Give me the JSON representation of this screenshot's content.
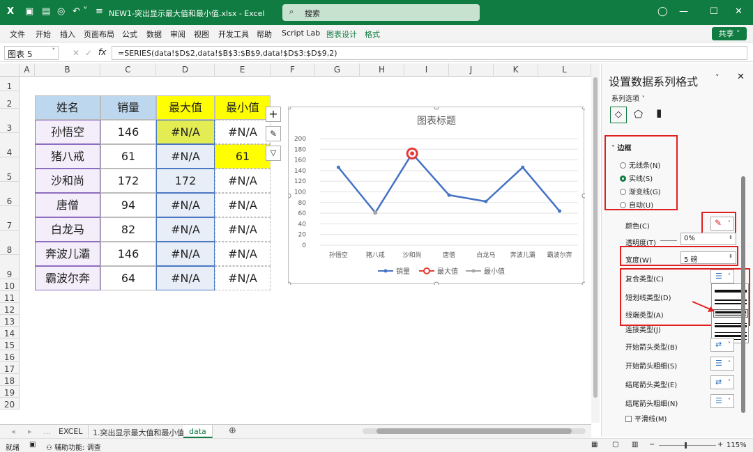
{
  "window": {
    "title": "NEW1-突出显示最大值和最小值.xlsx  -  Excel",
    "search_placeholder": "搜索"
  },
  "menu": [
    "文件",
    "开始",
    "插入",
    "页面布局",
    "公式",
    "数据",
    "审阅",
    "视图",
    "开发工具",
    "帮助",
    "Script Lab",
    "图表设计",
    "格式"
  ],
  "share_label": "共享",
  "formula_bar": {
    "name_box": "图表 5",
    "fx": "fx",
    "formula": "=SERIES(data!$D$2,data!$B$3:$B$9,data!$D$3:$D$9,2)"
  },
  "columns": [
    "A",
    "B",
    "C",
    "D",
    "E",
    "F",
    "G",
    "H",
    "I",
    "J",
    "K",
    "L"
  ],
  "rows": [
    "1",
    "2",
    "3",
    "4",
    "5",
    "6",
    "7",
    "8",
    "9",
    "10",
    "11",
    "12",
    "13",
    "14",
    "15",
    "16",
    "17",
    "18",
    "19",
    "20"
  ],
  "table": {
    "headers": [
      "姓名",
      "销量",
      "最大值",
      "最小值"
    ],
    "rows": [
      [
        "孙悟空",
        "146",
        "#N/A",
        "#N/A"
      ],
      [
        "猪八戒",
        "61",
        "#N/A",
        "61"
      ],
      [
        "沙和尚",
        "172",
        "172",
        "#N/A"
      ],
      [
        "唐僧",
        "94",
        "#N/A",
        "#N/A"
      ],
      [
        "白龙马",
        "82",
        "#N/A",
        "#N/A"
      ],
      [
        "奔波儿灞",
        "146",
        "#N/A",
        "#N/A"
      ],
      [
        "霸波尔奔",
        "64",
        "#N/A",
        "#N/A"
      ]
    ]
  },
  "chart_data": {
    "type": "line",
    "title": "图表标题",
    "categories": [
      "孙悟空",
      "猪八戒",
      "沙和尚",
      "唐僧",
      "白龙马",
      "奔波儿灞",
      "霸波尔奔"
    ],
    "series": [
      {
        "name": "销量",
        "values": [
          146,
          61,
          172,
          94,
          82,
          146,
          64
        ],
        "color": "#4472c4"
      },
      {
        "name": "最大值",
        "values": [
          null,
          null,
          172,
          null,
          null,
          null,
          null
        ],
        "color": "#e53935"
      },
      {
        "name": "最小值",
        "values": [
          null,
          61,
          null,
          null,
          null,
          null,
          null
        ],
        "color": "#a5a5a5"
      }
    ],
    "ylim": [
      0,
      200
    ],
    "yticks": [
      "200",
      "180",
      "160",
      "140",
      "120",
      "100",
      "80",
      "60",
      "40",
      "20",
      "0"
    ],
    "legend_position": "bottom",
    "grid": true
  },
  "panel": {
    "title": "设置数据系列格式",
    "series_options": "系列选项",
    "section": "边框",
    "radios": [
      "无线条(N)",
      "实线(S)",
      "渐变线(G)",
      "自动(U)"
    ],
    "selected_radio": 1,
    "color_label": "颜色(C)",
    "transparency_label": "透明度(T)",
    "transparency_value": "0%",
    "width_label": "宽度(W)",
    "width_value": "5 磅",
    "compound_label": "复合类型(C)",
    "dash_label": "短划线类型(D)",
    "cap_label": "线端类型(A)",
    "join_label": "连接类型(J)",
    "begin_arrow_type": "开始箭头类型(B)",
    "begin_arrow_size": "开始箭头粗细(S)",
    "end_arrow_type": "结尾箭头类型(E)",
    "end_arrow_size": "结尾箭头粗细(N)",
    "smooth": "平滑线(M)"
  },
  "sheet_tabs": [
    "EXCEL",
    "1.突出显示最大值和最小值",
    "data"
  ],
  "active_tab": "data",
  "status": {
    "ready": "就绪",
    "accessibility": "辅助功能: 调查",
    "zoom": "115%"
  }
}
